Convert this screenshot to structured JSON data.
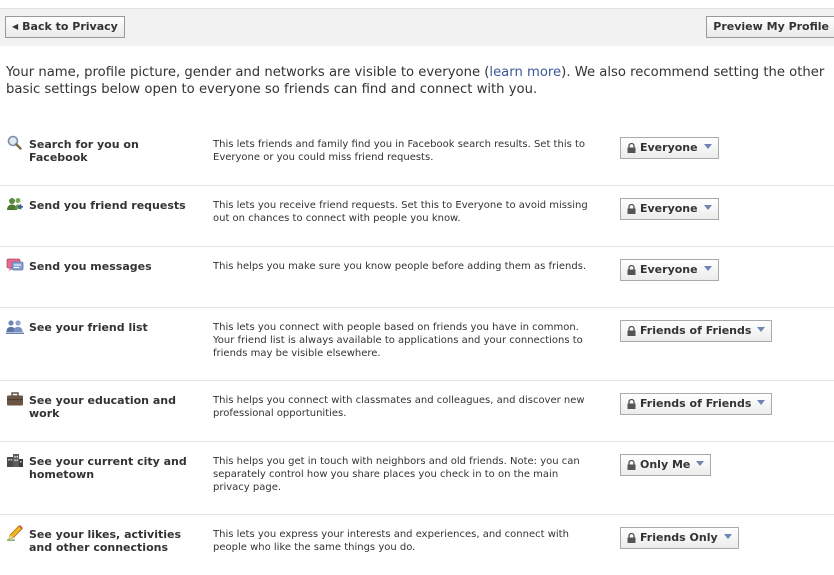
{
  "toolbar": {
    "back_label": "Back to Privacy",
    "preview_label": "Preview My Profile"
  },
  "intro": {
    "text_before": "Your name, profile picture, gender and networks are visible to everyone (",
    "link_text": "learn more",
    "text_after": "). We also recommend setting the other basic settings below open to everyone so friends can find and connect with you."
  },
  "settings": [
    {
      "icon": "search-icon",
      "title": "Search for you on Facebook",
      "description": "This lets friends and family find you in Facebook search results. Set this to Everyone or you could miss friend requests.",
      "value": "Everyone"
    },
    {
      "icon": "friend-request-icon",
      "title": "Send you friend requests",
      "description": "This lets you receive friend requests. Set this to Everyone to avoid missing out on chances to connect with people you know.",
      "value": "Everyone"
    },
    {
      "icon": "messages-icon",
      "title": "Send you messages",
      "description": "This helps you make sure you know people before adding them as friends.",
      "value": "Everyone"
    },
    {
      "icon": "friend-list-icon",
      "title": "See your friend list",
      "description": "This lets you connect with people based on friends you have in common. Your friend list is always available to applications and your connections to friends may be visible elsewhere.",
      "value": "Friends of Friends"
    },
    {
      "icon": "briefcase-icon",
      "title": "See your education and work",
      "description": "This helps you connect with classmates and colleagues, and discover new professional opportunities.",
      "value": "Friends of Friends"
    },
    {
      "icon": "city-icon",
      "title": "See your current city and hometown",
      "description": "This helps you get in touch with neighbors and old friends. Note: you can separately control how you share places you check in to on the main privacy page.",
      "value": "Only Me"
    },
    {
      "icon": "pencil-icon",
      "title": "See your likes, activities and other connections",
      "description": "This lets you express your interests and experiences, and connect with people who like the same things you do.",
      "value": "Friends Only"
    }
  ],
  "colors": {
    "link": "#3b5998",
    "caret": "#6d84b4",
    "divider": "#e2e2e2"
  }
}
